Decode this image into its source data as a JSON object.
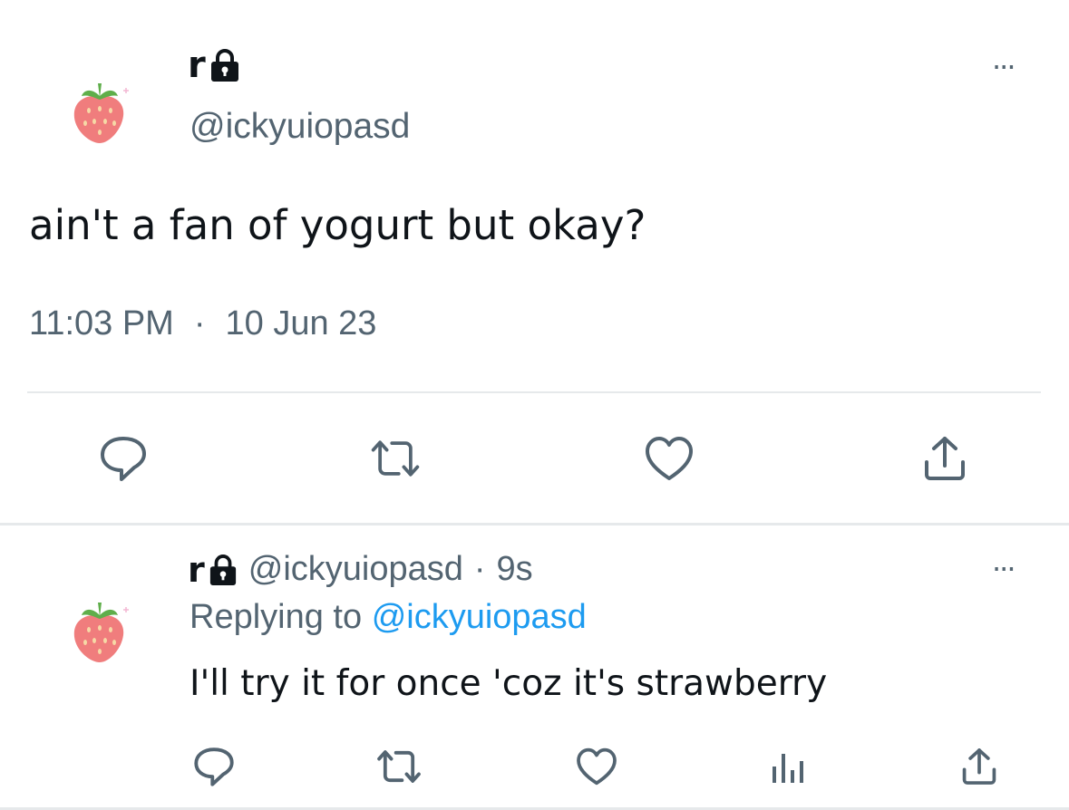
{
  "main_tweet": {
    "display_name": "r",
    "handle": "@ickyuiopasd",
    "text": "ain't a fan of yogurt but okay?",
    "time": "11:03 PM",
    "separator": "·",
    "date": "10 Jun 23",
    "more_label": "···",
    "avatar_icon": "strawberry-icon",
    "locked_icon": "lock-icon"
  },
  "reply_tweet": {
    "display_name": "r",
    "handle": "@ickyuiopasd",
    "age": "9s",
    "separator": "·",
    "replying_prefix": "Replying to",
    "replying_handle": "@ickyuiopasd",
    "text": "I'll try it for once 'coz it's strawberry",
    "more_label": "···"
  },
  "actions": {
    "main": [
      "reply-icon",
      "retweet-icon",
      "like-icon",
      "share-icon"
    ],
    "reply": [
      "reply-icon",
      "retweet-icon",
      "like-icon",
      "views-icon",
      "share-icon"
    ]
  },
  "colors": {
    "text": "#0f1419",
    "secondary": "#536471",
    "link": "#1d9bf0",
    "divider": "#e6e9eb"
  }
}
